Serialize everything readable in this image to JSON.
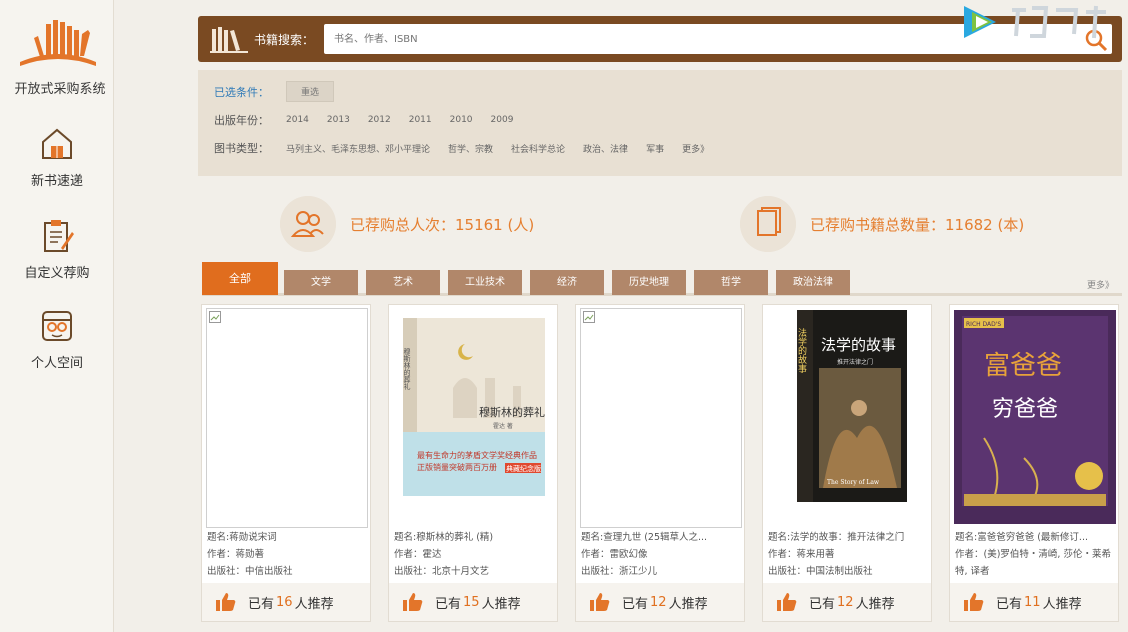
{
  "sidebar": {
    "title": "开放式采购系统",
    "items": [
      {
        "label": "新书速递",
        "icon": "house-book-icon"
      },
      {
        "label": "自定义荐购",
        "icon": "clipboard-pen-icon"
      },
      {
        "label": "个人空间",
        "icon": "person-glasses-icon"
      }
    ]
  },
  "search": {
    "label": "书籍搜索：",
    "placeholder": "书名、作者、ISBN"
  },
  "filters": {
    "selected_label": "已选条件：",
    "reset_label": "重选",
    "year_label": "出版年份：",
    "years": [
      "2014",
      "2013",
      "2012",
      "2011",
      "2010",
      "2009"
    ],
    "type_label": "图书类型：",
    "types": [
      "马列主义、毛泽东思想、邓小平理论",
      "哲学、宗教",
      "社会科学总论",
      "政治、法律",
      "军事",
      "更多》"
    ]
  },
  "stats": {
    "people": "已荐购总人次：15161 (人)",
    "books": "已荐购书籍总数量：11682 (本)"
  },
  "tabs": {
    "items": [
      "全部",
      "文学",
      "艺术",
      "工业技术",
      "经济",
      "历史地理",
      "哲学",
      "政治法律"
    ],
    "more": "更多》"
  },
  "books": [
    {
      "title": "题名:蒋勋说宋词",
      "author": "作者：蒋勋著",
      "publisher": "出版社：中信出版社",
      "count": "16",
      "cover": "broken"
    },
    {
      "title": "题名:穆斯林的葬礼 (精)",
      "author": "作者：霍达",
      "publisher": "出版社：北京十月文艺",
      "count": "15",
      "cover": "muslim",
      "cover_text": {
        "title": "穆斯林的葬礼",
        "vert": "穆斯林的葬礼",
        "author": "霍达 著",
        "line1": "最有生命力的茅盾文学奖经典作品",
        "line2": "正版销量突破两百万册",
        "badge": "典藏纪念版"
      }
    },
    {
      "title": "题名:查理九世 (25辑草人之...",
      "author": "作者：雷欧幻像",
      "publisher": "出版社：浙江少儿",
      "count": "12",
      "cover": "broken"
    },
    {
      "title": "题名:法学的故事：推开法律之门",
      "author": "作者：蒋来用著",
      "publisher": "出版社：中国法制出版社",
      "count": "12",
      "cover": "law",
      "cover_text": {
        "title": "法学的故事",
        "vert": "法学的故事",
        "sub": "推开法律之门",
        "en": "The Story of Law"
      }
    },
    {
      "title": "题名:富爸爸穷爸爸 (最新修订...",
      "author": "作者：(美)罗伯特・清崎, 莎伦・莱希特, 译者",
      "publisher": "",
      "count": "11",
      "cover": "richdad",
      "cover_text": {
        "title1": "富爸爸",
        "title2": "穷爸爸",
        "brand": "RICH DAD'S"
      }
    }
  ],
  "rec": {
    "prefix": "已有",
    "suffix": "人推荐"
  },
  "colors": {
    "accent": "#e06d1e",
    "brand_brown": "#7a4a22",
    "tab_brown": "#b1876a",
    "stat_orange": "#e57f30"
  }
}
